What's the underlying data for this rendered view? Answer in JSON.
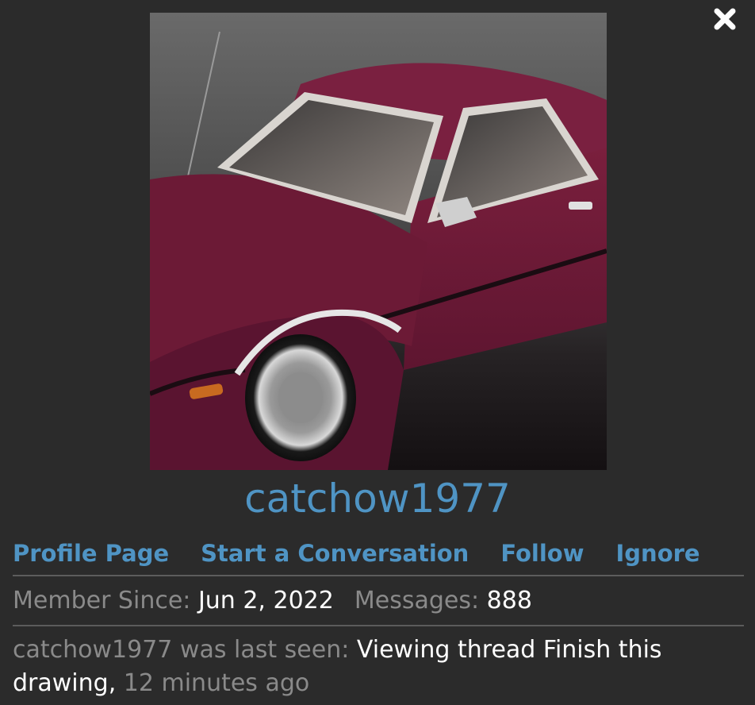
{
  "profile": {
    "username": "catchow1977",
    "avatar_alt": "Avatar"
  },
  "actions": {
    "profile_page": "Profile Page",
    "start_conversation": "Start a Conversation",
    "follow": "Follow",
    "ignore": "Ignore"
  },
  "stats": {
    "member_since_label": "Member Since:",
    "member_since_value": "Jun 2, 2022",
    "messages_label": "Messages:",
    "messages_value": "888"
  },
  "last_seen": {
    "label": "catchow1977 was last seen:",
    "activity": "Viewing thread Finish this drawing,",
    "time": "12 minutes ago"
  },
  "icons": {
    "close": "close-icon"
  },
  "colors": {
    "background": "#2b2b2b",
    "link": "#4f94c4",
    "muted_text": "#8a8a8a",
    "bright_text": "#ffffff",
    "divider": "#5c5c5c"
  }
}
